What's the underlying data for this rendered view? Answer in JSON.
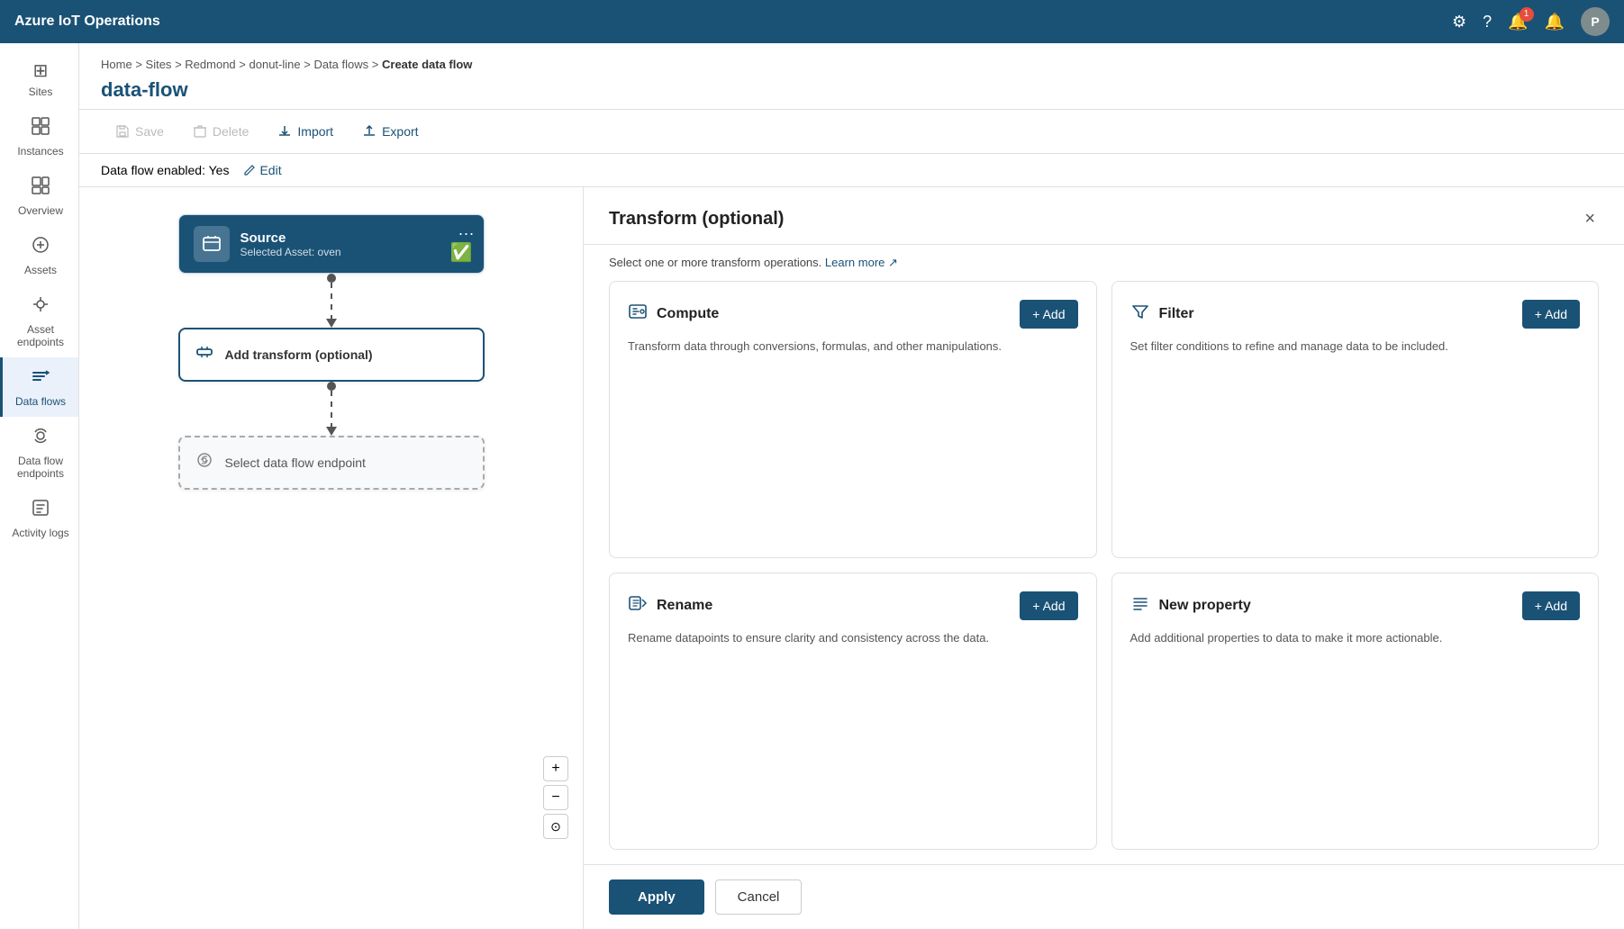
{
  "app": {
    "title": "Azure IoT Operations"
  },
  "topnav": {
    "title": "Azure IoT Operations",
    "avatar_label": "P",
    "notification_count": "1"
  },
  "breadcrumb": {
    "items": [
      "Home",
      "Sites",
      "Redmond",
      "donut-line",
      "Data flows"
    ],
    "current": "Create data flow"
  },
  "page": {
    "title": "data-flow"
  },
  "toolbar": {
    "save_label": "Save",
    "delete_label": "Delete",
    "import_label": "Import",
    "export_label": "Export"
  },
  "enabled_bar": {
    "text": "Data flow enabled: Yes",
    "edit_label": "Edit"
  },
  "sidebar": {
    "items": [
      {
        "id": "sites",
        "label": "Sites",
        "icon": "⊞"
      },
      {
        "id": "instances",
        "label": "Instances",
        "icon": "⬡"
      },
      {
        "id": "overview",
        "label": "Overview",
        "icon": "◫"
      },
      {
        "id": "assets",
        "label": "Assets",
        "icon": "◈"
      },
      {
        "id": "asset-endpoints",
        "label": "Asset endpoints",
        "icon": "⬡"
      },
      {
        "id": "data-flows",
        "label": "Data flows",
        "icon": "⇄"
      },
      {
        "id": "data-flow-endpoints",
        "label": "Data flow endpoints",
        "icon": "⬡"
      },
      {
        "id": "activity-logs",
        "label": "Activity logs",
        "icon": "≡"
      }
    ]
  },
  "flow": {
    "source_node": {
      "title": "Source",
      "subtitle": "Selected Asset: oven"
    },
    "transform_node": {
      "label": "Add transform (optional)"
    },
    "endpoint_node": {
      "label": "Select data flow endpoint"
    }
  },
  "transform_panel": {
    "title": "Transform (optional)",
    "description": "Select one or more transform operations.",
    "learn_more_label": "Learn more",
    "close_label": "×",
    "cards": [
      {
        "id": "compute",
        "icon": "⚙",
        "title": "Compute",
        "description": "Transform data through conversions, formulas, and other manipulations.",
        "add_label": "+ Add"
      },
      {
        "id": "filter",
        "icon": "⊞",
        "title": "Filter",
        "description": "Set filter conditions to refine and manage data to be included.",
        "add_label": "+ Add"
      },
      {
        "id": "rename",
        "icon": "⊡",
        "title": "Rename",
        "description": "Rename datapoints to ensure clarity and consistency across the data.",
        "add_label": "+ Add"
      },
      {
        "id": "new-property",
        "icon": "≡",
        "title": "New property",
        "description": "Add additional properties to data to make it more actionable.",
        "add_label": "+ Add"
      }
    ],
    "apply_label": "Apply",
    "cancel_label": "Cancel"
  }
}
